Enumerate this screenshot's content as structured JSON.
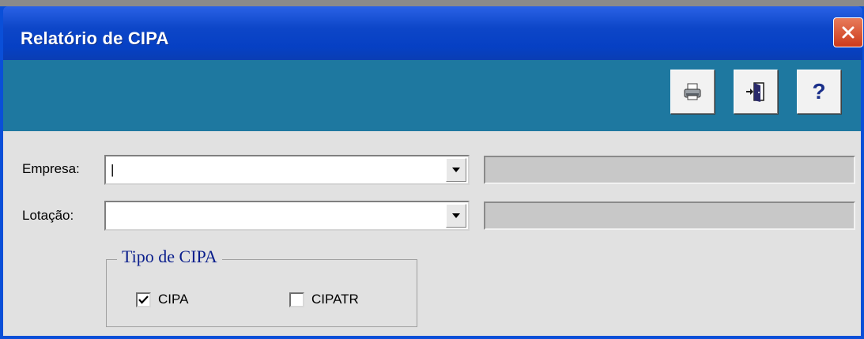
{
  "window": {
    "title": "Relatório de CIPA",
    "close_icon": "close-icon"
  },
  "toolbar": {
    "buttons": [
      {
        "name": "print-button",
        "icon": "printer-icon"
      },
      {
        "name": "exit-button",
        "icon": "exit-door-icon"
      },
      {
        "name": "help-button",
        "icon": "help-icon",
        "glyph": "?"
      }
    ]
  },
  "form": {
    "empresa_label": "Empresa:",
    "empresa_value": "|",
    "empresa_description": "",
    "lotacao_label": "Lotação:",
    "lotacao_value": "",
    "lotacao_description": ""
  },
  "tipo_cipa": {
    "legend": "Tipo de CIPA",
    "options": [
      {
        "label": "CIPA",
        "checked": true
      },
      {
        "label": "CIPATR",
        "checked": false
      }
    ]
  },
  "colors": {
    "title_bar": "#0640c4",
    "toolbar": "#1e78a0",
    "close": "#cc3a1b",
    "legend": "#0a1e8c"
  }
}
